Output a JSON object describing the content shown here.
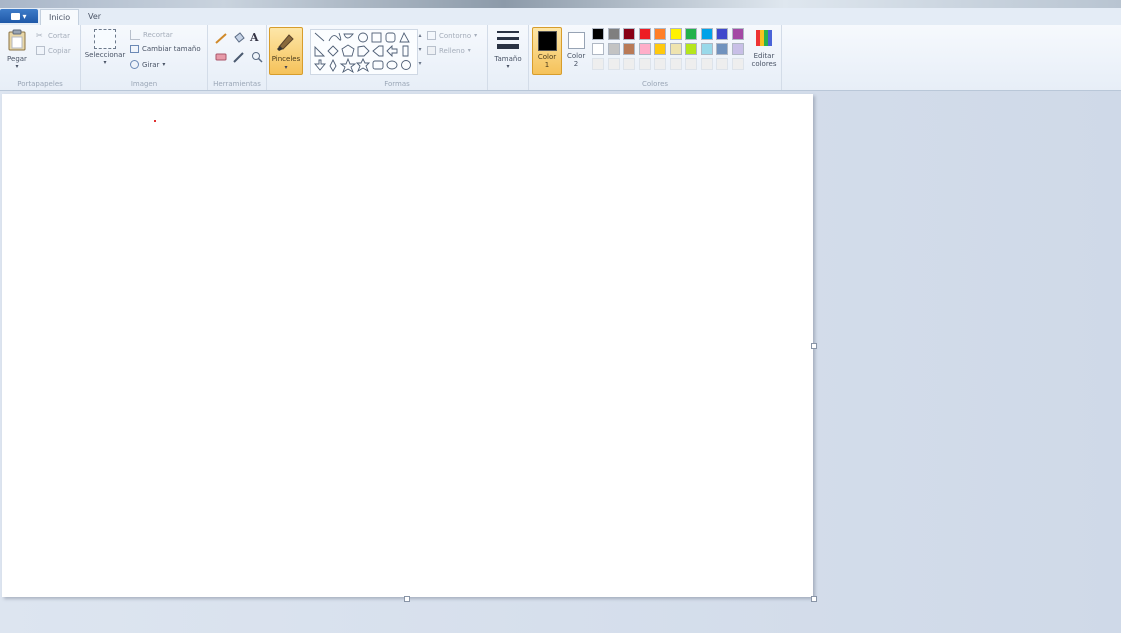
{
  "file_button": "▾",
  "tabs": [
    {
      "label": "Inicio",
      "active": true
    },
    {
      "label": "Ver",
      "active": false
    }
  ],
  "groups": {
    "portapapeles": {
      "label": "Portapapeles",
      "pegar": "Pegar",
      "cortar": "Cortar",
      "copiar": "Copiar"
    },
    "imagen": {
      "label": "Imagen",
      "seleccionar": "Seleccionar",
      "recortar": "Recortar",
      "cambiar_tamano": "Cambiar tamaño",
      "girar": "Girar"
    },
    "herramientas": {
      "label": "Herramientas"
    },
    "pinceles": {
      "label": "Pinceles"
    },
    "formas": {
      "label": "Formas",
      "contorno": "Contorno",
      "relleno": "Relleno"
    },
    "tamano": {
      "label": "Tamaño"
    },
    "colores": {
      "label": "Colores",
      "color1": "Color 1",
      "color2": "Color 2",
      "editar": "Editar colores",
      "color1_value": "#000000",
      "color2_value": "#ffffff",
      "palette_row1": [
        "#000000",
        "#7f7f7f",
        "#880015",
        "#ed1c24",
        "#ff7f27",
        "#fff200",
        "#22b14c",
        "#00a2e8",
        "#3f48cc",
        "#a349a4"
      ],
      "palette_row2": [
        "#ffffff",
        "#c3c3c3",
        "#b97a57",
        "#ffaec9",
        "#ffc90e",
        "#efe4b0",
        "#b5e61d",
        "#99d9ea",
        "#7092be",
        "#c8bfe7"
      ],
      "palette_row3": [
        "#eeeeee",
        "#eeeeee",
        "#eeeeee",
        "#eeeeee",
        "#eeeeee",
        "#eeeeee",
        "#eeeeee",
        "#eeeeee",
        "#eeeeee",
        "#eeeeee"
      ]
    }
  },
  "accent": "#f5c25a"
}
